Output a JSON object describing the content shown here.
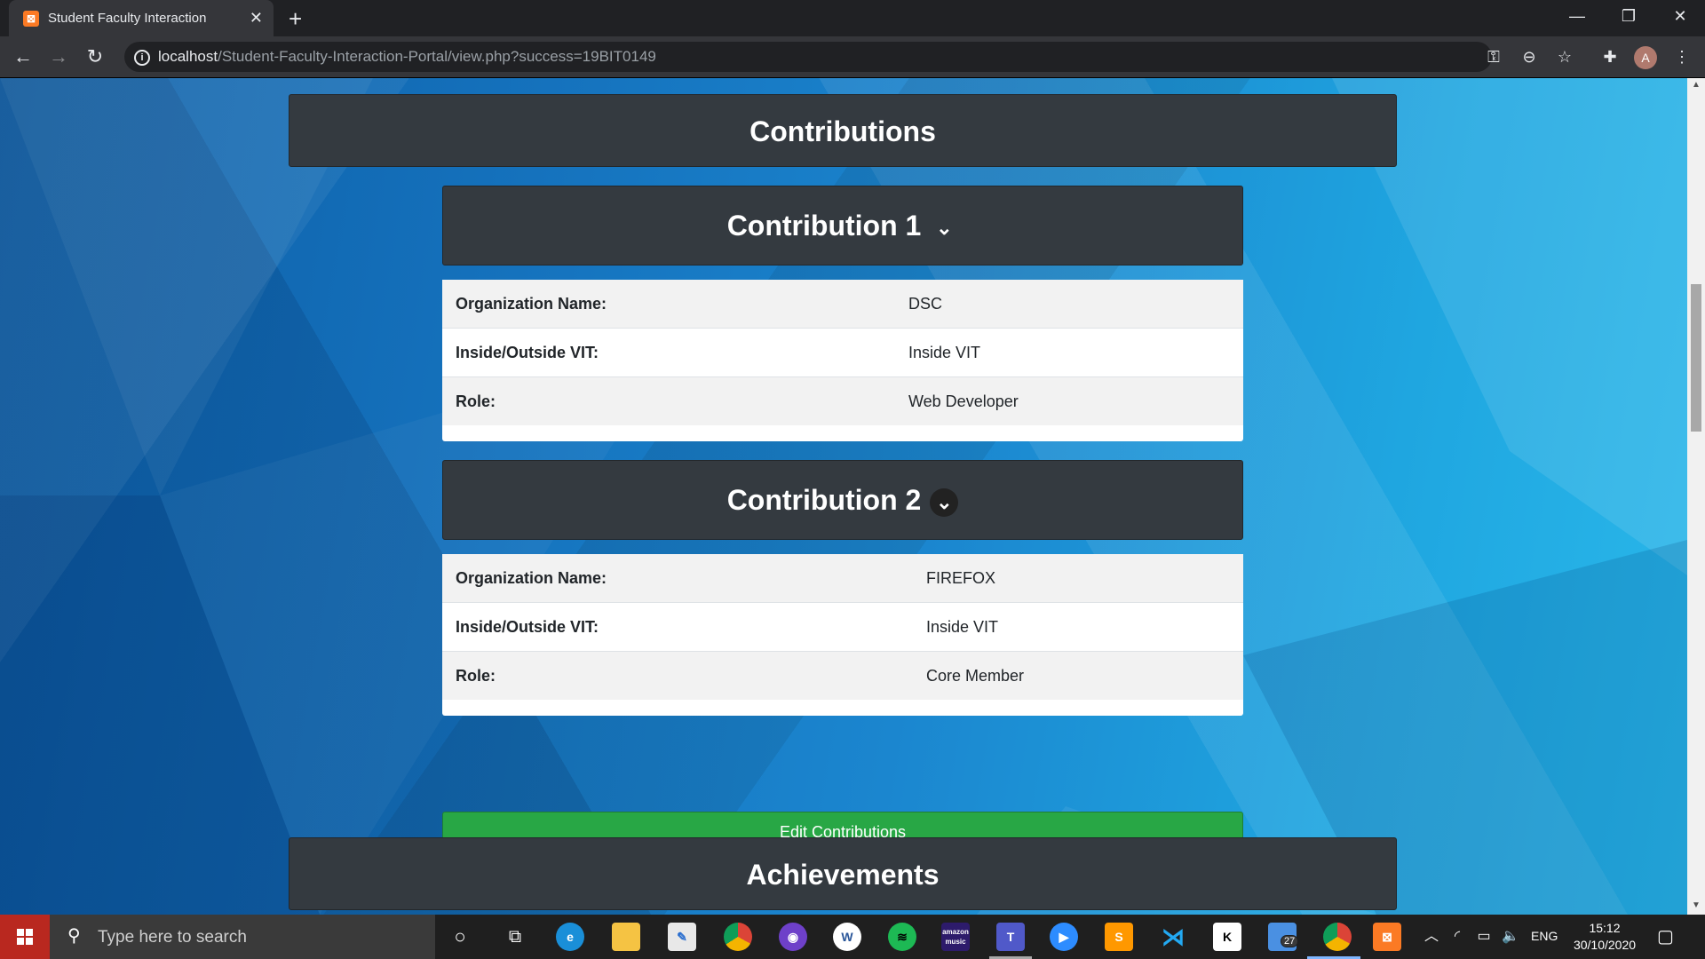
{
  "browser": {
    "tab_title": "Student Faculty Interaction",
    "tab_close": "✕",
    "new_tab": "+",
    "url_host": "localhost",
    "url_path": "/Student-Faculty-Interaction-Portal/view.php?success=19BIT0149",
    "profile_initial": "A",
    "window_controls": {
      "minimize": "—",
      "restore": "❐",
      "close": "✕"
    }
  },
  "page": {
    "contributions_title": "Contributions",
    "contributions": [
      {
        "title": "Contribution 1",
        "rows": [
          {
            "label": "Organization Name:",
            "value": "DSC"
          },
          {
            "label": "Inside/Outside VIT:",
            "value": "Inside VIT"
          },
          {
            "label": "Role:",
            "value": "Web Developer"
          }
        ]
      },
      {
        "title": "Contribution 2",
        "rows": [
          {
            "label": "Organization Name:",
            "value": "FIREFOX"
          },
          {
            "label": "Inside/Outside VIT:",
            "value": "Inside VIT"
          },
          {
            "label": "Role:",
            "value": "Core Member"
          }
        ]
      }
    ],
    "edit_button": "Edit Contributions",
    "achievements_title": "Achievements"
  },
  "taskbar": {
    "search_placeholder": "Type here to search",
    "badge_count": "27",
    "language": "ENG",
    "time": "15:12",
    "date": "30/10/2020",
    "apps": [
      "cortana-icon",
      "task-view-icon",
      "edge-icon",
      "file-explorer-icon",
      "notepad-icon",
      "chrome-icon",
      "github-icon",
      "word-icon",
      "spotify-icon",
      "amazon-music-icon",
      "teams-icon",
      "zoom-icon",
      "sublime-icon",
      "vscode-icon",
      "kotlin-icon",
      "sticky-icon",
      "chrome-profile-icon",
      "xampp-icon"
    ]
  },
  "colors": {
    "header_dark": "#343a40",
    "edit_green": "#28a745",
    "tab_active": "#35363a",
    "start_red": "#b9281f"
  }
}
